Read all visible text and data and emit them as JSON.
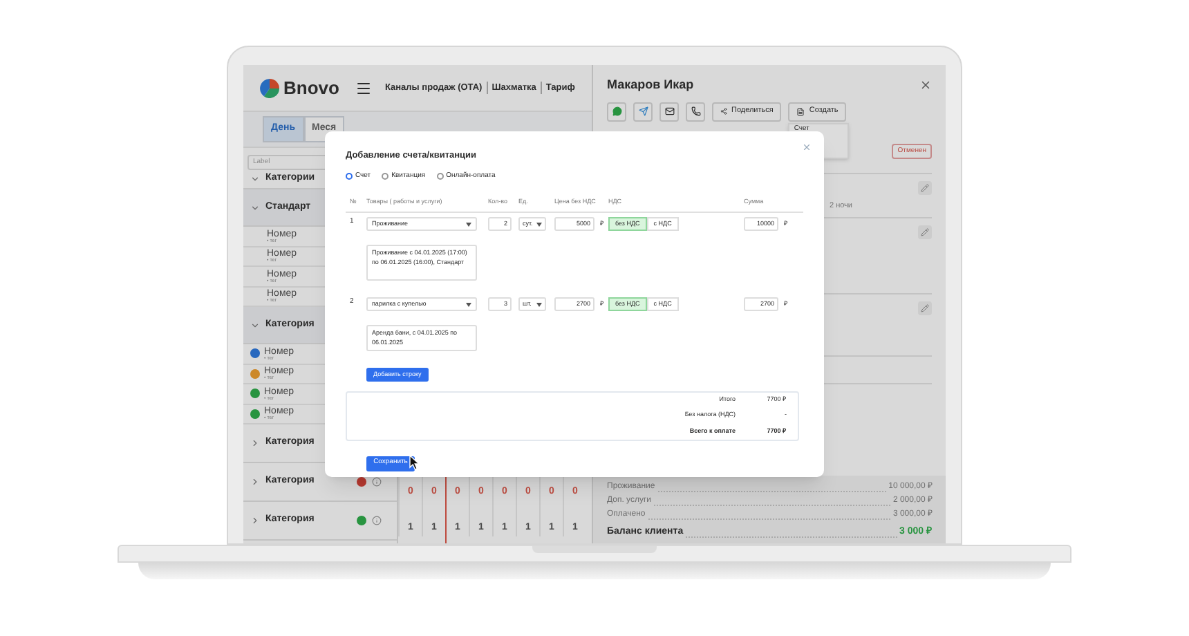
{
  "app": {
    "logo": "Bnovo",
    "nav": [
      "Каналы продаж (ОТА)",
      "Шахматка",
      "Тариф"
    ],
    "view_tabs": [
      {
        "label": "День",
        "selected": true
      },
      {
        "label": "Меся",
        "selected": false
      }
    ],
    "sidebar": {
      "search": {
        "placeholder": "Label"
      },
      "categories": [
        {
          "label": "Категории",
          "expanded": true
        },
        {
          "label": "Стандарт",
          "expanded": true,
          "children": [
            {
              "name": "Номер",
              "tag": "• тег"
            },
            {
              "name": "Номер",
              "tag": "• тег"
            },
            {
              "name": "Номер",
              "tag": "• тег"
            },
            {
              "name": "Номер",
              "tag": "• тег"
            }
          ]
        },
        {
          "label": "Категория",
          "expanded": true,
          "children": [
            {
              "name": "Номер",
              "tag": "• тег",
              "color": "#2868be"
            },
            {
              "name": "Номер",
              "tag": "• тег",
              "color": "#cc8829"
            },
            {
              "name": "Номер",
              "tag": "• тег",
              "color": "#289440"
            },
            {
              "name": "Номер",
              "tag": "• тег",
              "color": "#289440"
            }
          ]
        },
        {
          "label": "Категория",
          "expanded": false
        },
        {
          "label": "Категория",
          "expanded": false,
          "color": "#b83a31"
        },
        {
          "label": "Категория",
          "expanded": false,
          "color": "#289440"
        }
      ]
    },
    "calendar": {
      "rows": [
        {
          "color": "#be4b3f",
          "cells": [
            "0",
            "0",
            "0",
            "0",
            "0",
            "0",
            "0",
            "0"
          ]
        },
        {
          "color": "#484848",
          "cells": [
            "1",
            "1",
            "1",
            "1",
            "1",
            "1",
            "1",
            "1"
          ]
        }
      ]
    }
  },
  "guest_panel": {
    "name": "Макаров Икар",
    "share_button": "Поделиться",
    "create_button": "Создать",
    "create_menu": [
      "Счет"
    ],
    "status_badge": "Отменен",
    "nights": "2 ночи",
    "summary": [
      {
        "label": "Проживание",
        "value": "10 000,00 ₽"
      },
      {
        "label": "Доп. услуги",
        "value": "2 000,00 ₽"
      },
      {
        "label": "Оплачено",
        "value": "3 000,00 ₽"
      }
    ],
    "balance": {
      "label": "Баланс клиента",
      "value": "3 000 ₽"
    }
  },
  "modal": {
    "title": "Добавление счета/квитанции",
    "doc_types": [
      {
        "label": "Счет",
        "selected": true
      },
      {
        "label": "Квитанция",
        "selected": false
      },
      {
        "label": "Онлайн-оплата",
        "selected": false
      }
    ],
    "columns": [
      "№",
      "Товары ( работы и услуги)",
      "Кол-во",
      "Ед.",
      "Цена без НДС",
      "НДС",
      "Сумма"
    ],
    "rows": [
      {
        "number": "1",
        "item": "Проживание",
        "qty": "2",
        "unit": "сут.",
        "price": "5000",
        "currency": "₽",
        "vat_options": [
          {
            "label": "без НДС",
            "selected": true
          },
          {
            "label": "с НДС",
            "selected": false
          }
        ],
        "sum": "10000",
        "sum_currency": "₽",
        "description": "Проживание с 04.01.2025 (17:00) по 06.01.2025 (16:00), Стандарт"
      },
      {
        "number": "2",
        "item": "парилка с купелью",
        "qty": "3",
        "unit": "шт.",
        "price": "2700",
        "currency": "₽",
        "vat_options": [
          {
            "label": "без НДС",
            "selected": true
          },
          {
            "label": "с НДС",
            "selected": false
          }
        ],
        "sum": "2700",
        "sum_currency": "₽",
        "description": "Аренда бани, с 04.01.2025 по 06.01.2025"
      }
    ],
    "add_row_button": "Добавить строку",
    "totals": [
      {
        "label": "Итого",
        "value": "7700 ₽",
        "bold": false
      },
      {
        "label": "Без налога (НДС)",
        "value": "-",
        "bold": false
      },
      {
        "label": "Всего к оплате",
        "value": "7700 ₽",
        "bold": true
      }
    ],
    "save_button": "Сохранить"
  }
}
